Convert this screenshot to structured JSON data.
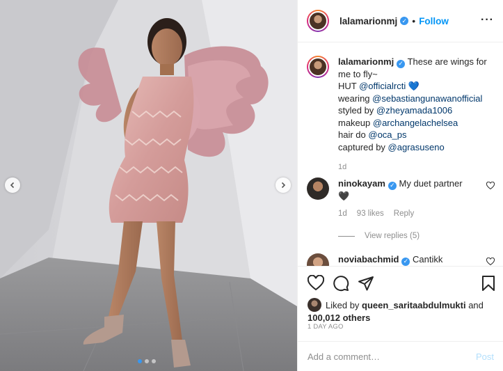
{
  "colors": {
    "accent": "#0095f6",
    "verified": "#3897f0",
    "muted": "#8e8e8e",
    "mention": "#00376b",
    "border": "#efefef"
  },
  "header": {
    "username": "lalamarionmj",
    "separator": "•",
    "follow_label": "Follow",
    "more_icon": "more-dots-icon"
  },
  "caption": {
    "username": "lalamarionmj",
    "lines": [
      {
        "text": " These are wings for me to fly~"
      },
      {
        "text": "HUT ",
        "mention": "@officialrcti",
        "suffix": " 💙"
      },
      {
        "text": "wearing ",
        "mention": "@sebastiangunawanofficial"
      },
      {
        "text": "styled by ",
        "mention": "@zheyamada1006"
      },
      {
        "text": "makeup ",
        "mention": "@archangelachelsea"
      },
      {
        "text": "hair do ",
        "mention": "@oca_ps"
      },
      {
        "text": "captured by ",
        "mention": "@agrasuseno"
      }
    ],
    "time": "1d"
  },
  "comments": [
    {
      "username": "ninokayam",
      "text": " My duet partner",
      "emoji": "🖤",
      "time": "1d",
      "likes": "93 likes",
      "reply": "Reply"
    },
    {
      "username": "noviabachmid",
      "text": " Cantikk"
    }
  ],
  "view_replies": "View replies (5)",
  "likes": {
    "prefix": "Liked by ",
    "user": "queen_saritaabdulmukti",
    "middle": " and",
    "count": "100,012 others"
  },
  "posted_ago": "1 DAY AGO",
  "comment_input": {
    "placeholder": "Add a comment…",
    "post_label": "Post"
  },
  "carousel": {
    "total": 3,
    "active": 1
  }
}
